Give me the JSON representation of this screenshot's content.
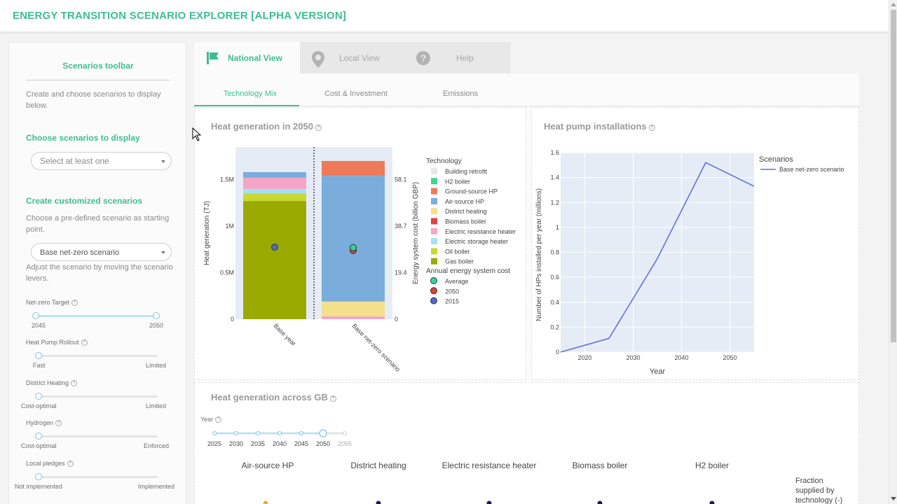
{
  "app": {
    "title": "ENERGY TRANSITION SCENARIO EXPLORER [ALPHA VERSION]"
  },
  "sidebar": {
    "title": "Scenarios toolbar",
    "intro": "Create and choose scenarios to display below.",
    "choose_heading": "Choose scenarios to display",
    "choose_placeholder": "Select at least one",
    "create_heading": "Create customized scenarios",
    "create_help": "Choose a pre-defined scenario as starting point.",
    "base_select": "Base net-zero scenario",
    "adjust_help": "Adjust the scenario by moving the scenario levers.",
    "levers": [
      {
        "label": "Net-zero Target",
        "min": "2045",
        "max": "2050",
        "value": 1
      },
      {
        "label": "Heat Pump Rollout",
        "min": "Fast",
        "max": "Limited",
        "value": 0
      },
      {
        "label": "District Heating",
        "min": "Cost-optimal",
        "max": "Limited",
        "value": 0
      },
      {
        "label": "Hydrogen",
        "min": "Cost-optimal",
        "max": "Enforced",
        "value": 0
      },
      {
        "label": "Local pledges",
        "min": "Not implemented",
        "max": "Implemented",
        "value": 0
      }
    ]
  },
  "tabs": [
    {
      "label": "National View",
      "icon": "flag-icon",
      "active": true
    },
    {
      "label": "Local View",
      "icon": "map-pin-icon",
      "active": false
    },
    {
      "label": "Help",
      "icon": "question-icon",
      "active": false
    }
  ],
  "subtabs": [
    {
      "label": "Technology Mix",
      "active": true
    },
    {
      "label": "Cost & Investment",
      "active": false
    },
    {
      "label": "Emissions",
      "active": false
    }
  ],
  "cards": {
    "heat_generation": {
      "title": "Heat generation in 2050"
    },
    "heat_pump": {
      "title": "Heat pump installations"
    },
    "across_gb": {
      "title": "Heat generation across GB",
      "year_label": "Year",
      "years": [
        "2025",
        "2030",
        "2035",
        "2040",
        "2045",
        "2050",
        "2055"
      ],
      "selected_year": "2050",
      "maps": [
        "Air-source HP",
        "District heating",
        "Electric resistance heater",
        "Biomass boiler",
        "H2 boiler"
      ],
      "colorbar_title": "Fraction supplied by technology (-)"
    }
  },
  "chart_data": [
    {
      "type": "bar",
      "stacked": true,
      "title": "Heat generation in 2050",
      "ylabel": "Heat generation (TJ)",
      "y2label": "Energy system cost (billion GBP)",
      "categories": [
        "Base year",
        "Base net-zero scenario"
      ],
      "ylim": [
        0,
        1850000
      ],
      "yticks": [
        "0",
        "0.5M",
        "1M",
        "1.5M"
      ],
      "y2ticks": [
        "0",
        "19.4",
        "38.7",
        "58.1"
      ],
      "y2lim": [
        0,
        71.7
      ],
      "series": [
        {
          "name": "Gas boiler",
          "color": "#9aaa00",
          "values": [
            1270000,
            0
          ]
        },
        {
          "name": "Oil boiler",
          "color": "#c8d834",
          "values": [
            80000,
            0
          ]
        },
        {
          "name": "Electric storage heater",
          "color": "#a6e0f5",
          "values": [
            50000,
            0
          ]
        },
        {
          "name": "Electric resistance heater",
          "color": "#f5a6c6",
          "values": [
            120000,
            30000
          ]
        },
        {
          "name": "Biomass boiler",
          "color": "#e34141",
          "values": [
            0,
            0
          ]
        },
        {
          "name": "District heating",
          "color": "#f3e08c",
          "values": [
            0,
            160000
          ]
        },
        {
          "name": "Air-source HP",
          "color": "#7aaddb",
          "values": [
            60000,
            1350000
          ]
        },
        {
          "name": "Ground-source HP",
          "color": "#ef7a5a",
          "values": [
            0,
            160000
          ]
        },
        {
          "name": "H2 boiler",
          "color": "#3ad68e",
          "values": [
            0,
            0
          ]
        },
        {
          "name": "Building retrofit",
          "color": "#e7e7e7",
          "values": [
            0,
            0
          ]
        }
      ],
      "legend_title": "Technology",
      "legend_items": [
        "Building retrofit",
        "H2 boiler",
        "Ground-source HP",
        "Air-source HP",
        "District heating",
        "Biomass boiler",
        "Electric resistance heater",
        "Electric storage heater",
        "Oil boiler",
        "Gas boiler"
      ],
      "cost_legend_title": "Annual energy system cost",
      "cost_series": [
        {
          "name": "Average",
          "color": "#2ed79a",
          "values": [
            null,
            29.8
          ]
        },
        {
          "name": "2050",
          "color": "#d84638",
          "values": [
            null,
            28.6
          ]
        },
        {
          "name": "2015",
          "color": "#5566cc",
          "values": [
            30.0,
            null
          ]
        }
      ]
    },
    {
      "type": "line",
      "title": "Heat pump installations",
      "xlabel": "Year",
      "ylabel": "Number of HPs installed per year (millions)",
      "xlim": [
        2015,
        2055
      ],
      "ylim": [
        0,
        1.6
      ],
      "xticks": [
        "2020",
        "2030",
        "2040",
        "2050"
      ],
      "yticks": [
        "0",
        "0.2",
        "0.4",
        "0.6",
        "0.8",
        "1",
        "1.2",
        "1.4",
        "1.6"
      ],
      "legend_title": "Scenarios",
      "series": [
        {
          "name": "Base net-zero scenario",
          "color": "#6470d8",
          "x": [
            2015,
            2025,
            2035,
            2045,
            2055
          ],
          "y": [
            0.0,
            0.11,
            0.75,
            1.52,
            1.33
          ]
        }
      ]
    }
  ]
}
